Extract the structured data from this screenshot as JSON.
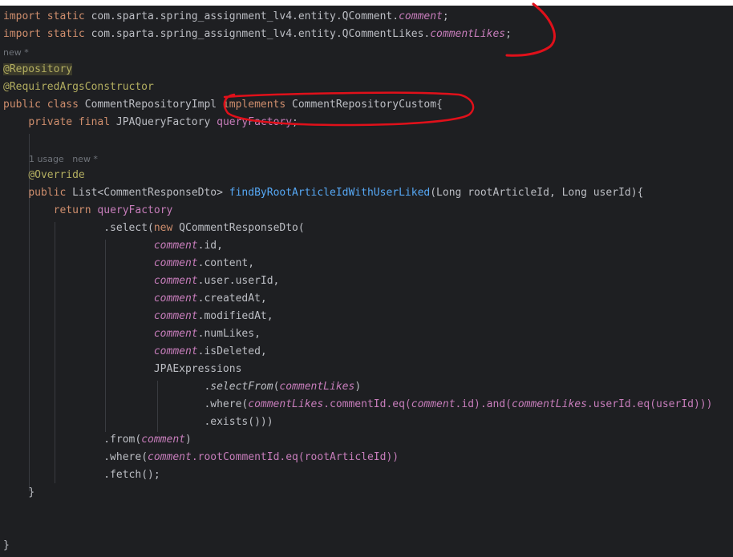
{
  "lines": {
    "l1": {
      "kw": "import static ",
      "pkg": "com.sparta.spring_assignment_lv4.entity.QComment.",
      "field": "comment",
      "end": ";"
    },
    "l2": {
      "kw": "import static ",
      "pkg": "com.sparta.spring_assignment_lv4.entity.QCommentLikes.",
      "field": "commentLikes",
      "end": ";"
    },
    "hint1": "new *",
    "l3": "@Repository",
    "l4": "@RequiredArgsConstructor",
    "l5": {
      "kw1": "public class ",
      "name": "CommentRepositoryImpl ",
      "kw2": "implements ",
      "iface": "CommentRepositoryCustom{"
    },
    "l6": {
      "kw": "private final ",
      "type": "JPAQueryFactory ",
      "field": "queryFactory",
      "end": ";"
    },
    "hint2": {
      "usage": "1 usage",
      "new": "new *"
    },
    "l7": "@Override",
    "l8": {
      "kw": "public ",
      "type": "List<CommentResponseDto> ",
      "method": "findByRootArticleIdWithUserLiked",
      "params_a": "(Long rootArticleId, Long userId){"
    },
    "l9": {
      "kw": "return ",
      "field": "queryFactory"
    },
    "l10": {
      "pre": ".select(",
      "kw": "new ",
      "rest": "QCommentResponseDto("
    },
    "l11": {
      "field": "comment",
      "rest": ".id,"
    },
    "l12": {
      "field": "comment",
      "rest": ".content,"
    },
    "l13": {
      "field": "comment",
      "rest": ".user.userId,"
    },
    "l14": {
      "field": "comment",
      "rest": ".createdAt,"
    },
    "l15": {
      "field": "comment",
      "rest": ".modifiedAt,"
    },
    "l16": {
      "field": "comment",
      "rest": ".numLikes,"
    },
    "l17": {
      "field": "comment",
      "rest": ".isDeleted,"
    },
    "l18": "JPAExpressions",
    "l19": {
      "pre": ".",
      "method": "selectFrom",
      "open": "(",
      "field": "commentLikes",
      "close": ")"
    },
    "l20": {
      "pre": ".where(",
      "f1": "commentLikes",
      "m1": ".commentId.eq(",
      "f2": "comment",
      "m2": ".id).and(",
      "f3": "commentLikes",
      "m3": ".userId.eq(userId)))"
    },
    "l21": ".exists()))",
    "l22": {
      "pre": ".from(",
      "field": "comment",
      "end": ")"
    },
    "l23": {
      "pre": ".where(",
      "field": "comment",
      "rest": ".rootCommentId.eq(rootArticleId))"
    },
    "l24": ".fetch();",
    "l25": "}",
    "l26": "}"
  },
  "colors": {
    "background": "#1e1f22",
    "keyword": "#cf8e6d",
    "annotation": "#b3ae60",
    "field": "#c77dbb",
    "method": "#56a8f5",
    "text": "#bcbec4",
    "hint": "#6f737a",
    "markup": "#e0101a"
  }
}
